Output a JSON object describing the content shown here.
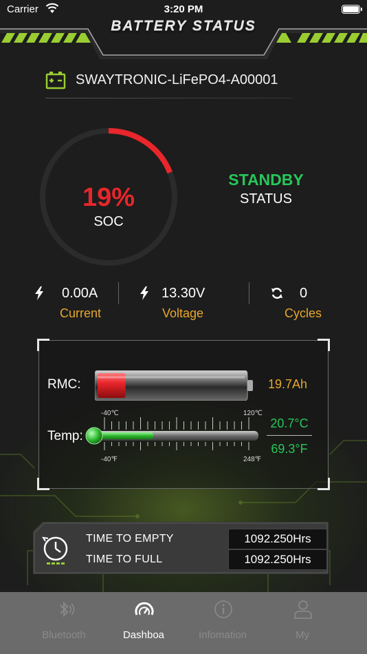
{
  "status_bar": {
    "carrier": "Carrier",
    "time": "3:20 PM"
  },
  "header": {
    "title": "BATTERY STATUS"
  },
  "device": {
    "name": "SWAYTRONIC-LiFePO4-A00001",
    "icon": "battery-icon"
  },
  "soc": {
    "value": "19%",
    "label": "SOC",
    "fraction": 0.19,
    "color": "#e8262b"
  },
  "state": {
    "value": "STANDBY",
    "label": "STATUS",
    "color": "#27c75a"
  },
  "metrics": [
    {
      "icon": "lightning-icon",
      "value": "0.00A",
      "label": "Current"
    },
    {
      "icon": "lightning-icon",
      "value": "13.30V",
      "label": "Voltage"
    },
    {
      "icon": "refresh-icon",
      "value": "0",
      "label": "Cycles"
    }
  ],
  "rmc": {
    "label": "RMC:",
    "value": "19.7Ah",
    "fraction": 0.19
  },
  "temp": {
    "label": "Temp:",
    "celsius": "20.7°C",
    "fahrenheit": "69.3°F",
    "min_c": "-40℃",
    "max_c": "120℃",
    "min_f": "-40℉",
    "max_f": "248℉",
    "fraction": 0.38
  },
  "time": {
    "empty_label": "TIME TO EMPTY",
    "empty_value": "1092.250Hrs",
    "full_label": "TIME TO FULL",
    "full_value": "1092.250Hrs"
  },
  "tabs": [
    {
      "label": "Bluetooth",
      "icon": "bluetooth-icon",
      "active": false
    },
    {
      "label": "Dashboa",
      "icon": "speedometer-icon",
      "active": true
    },
    {
      "label": "Infomation",
      "icon": "info-icon",
      "active": false
    },
    {
      "label": "My",
      "icon": "user-icon",
      "active": false
    }
  ],
  "colors": {
    "accent_green": "#27c75a",
    "accent_orange": "#e9a72e",
    "alert_red": "#e8262b",
    "header_lime": "#9acd32"
  }
}
